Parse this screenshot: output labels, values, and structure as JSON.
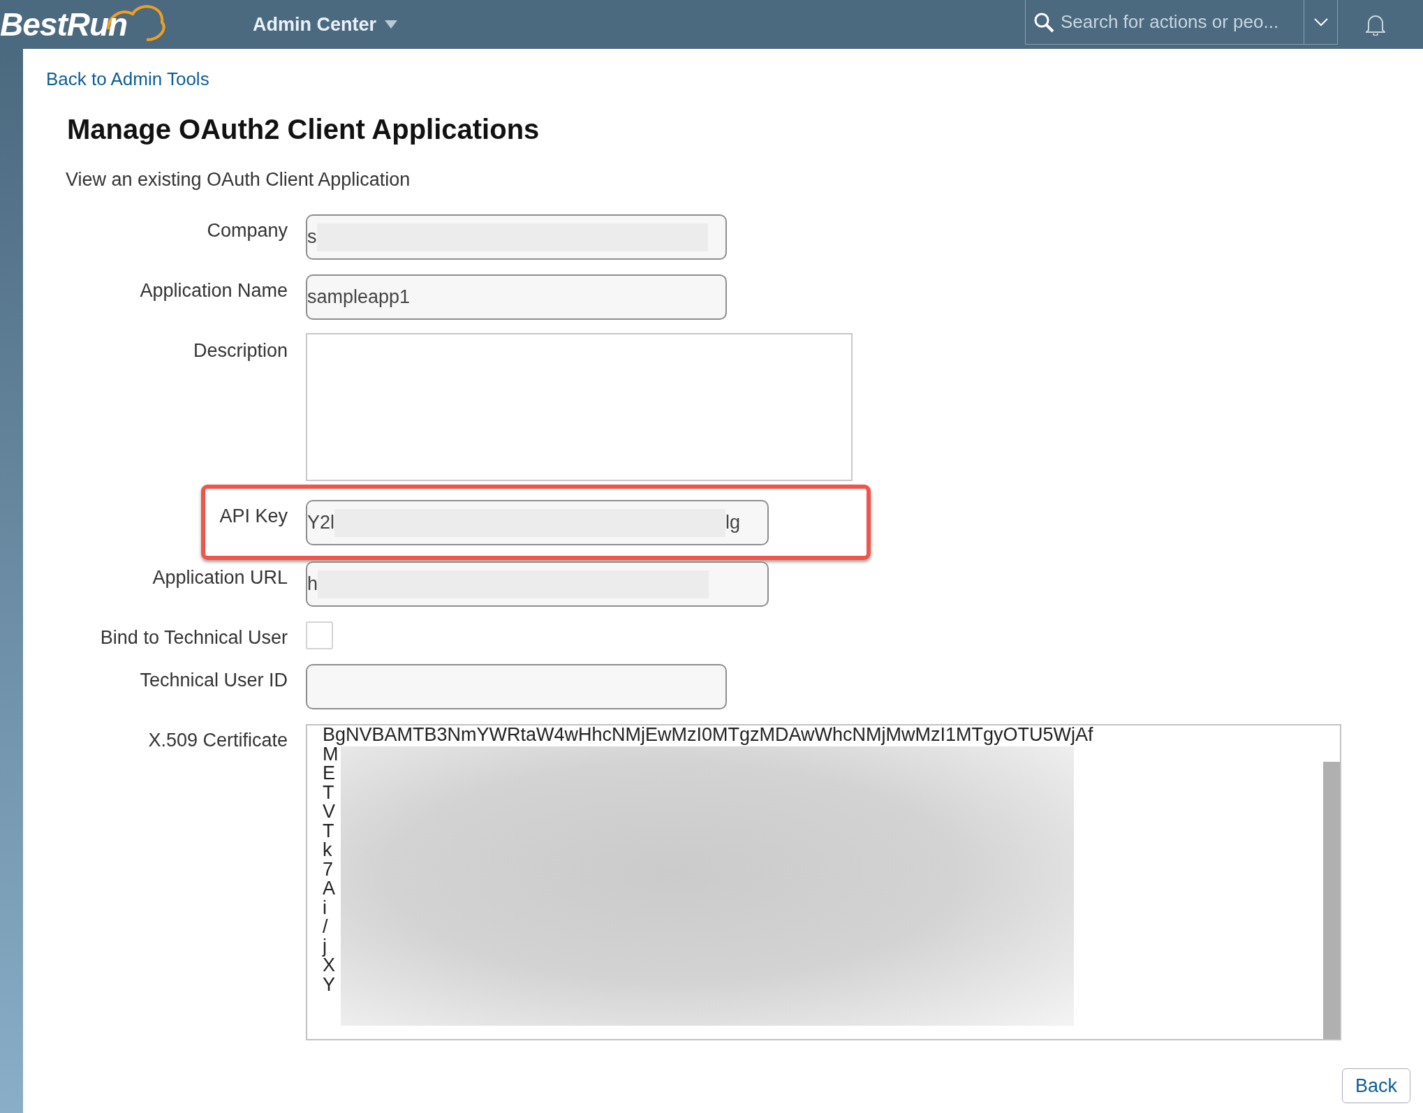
{
  "header": {
    "logo": "BestRun",
    "module": "Admin Center",
    "search": {
      "placeholder": "Search for actions or peo..."
    }
  },
  "back_link": "Back to Admin Tools",
  "title": "Manage OAuth2 Client Applications",
  "subtitle": "View an existing OAuth Client Application",
  "fields": [
    {
      "kind": "input",
      "label": "Company",
      "value": "s",
      "redacted": true,
      "wide": false,
      "highlighted": false
    },
    {
      "kind": "input",
      "label": "Application Name",
      "value": "sampleapp1",
      "redacted": false,
      "wide": false,
      "highlighted": false
    },
    {
      "kind": "textarea",
      "label": "Description",
      "highlighted": false
    },
    {
      "kind": "input",
      "label": "API Key",
      "value": "Y2l",
      "value_end": "lg",
      "redacted": true,
      "wide": true,
      "highlighted": true
    },
    {
      "kind": "input",
      "label": "Application URL",
      "value": "h",
      "redacted": true,
      "wide": true,
      "highlighted": false
    },
    {
      "kind": "checkbox",
      "label": "Bind to Technical User",
      "checked": false,
      "highlighted": false
    },
    {
      "kind": "input",
      "label": "Technical User ID",
      "redacted": false,
      "wide": false,
      "highlighted": false
    },
    {
      "kind": "certificate",
      "label": "X.509 Certificate",
      "redacted": true,
      "highlighted": false,
      "lines": [
        "BgNVBAMTB3NmYWRtaW4wHhcNMjEwMzI0MTgzMDAwWhcNMjMwMzI1MTgyOTU5WjAf",
        "M",
        "E",
        "T",
        "V",
        "T",
        "k",
        "7",
        "A",
        "i",
        "/",
        "j",
        "X",
        "Y"
      ]
    }
  ],
  "buttons": [
    "Back"
  ]
}
